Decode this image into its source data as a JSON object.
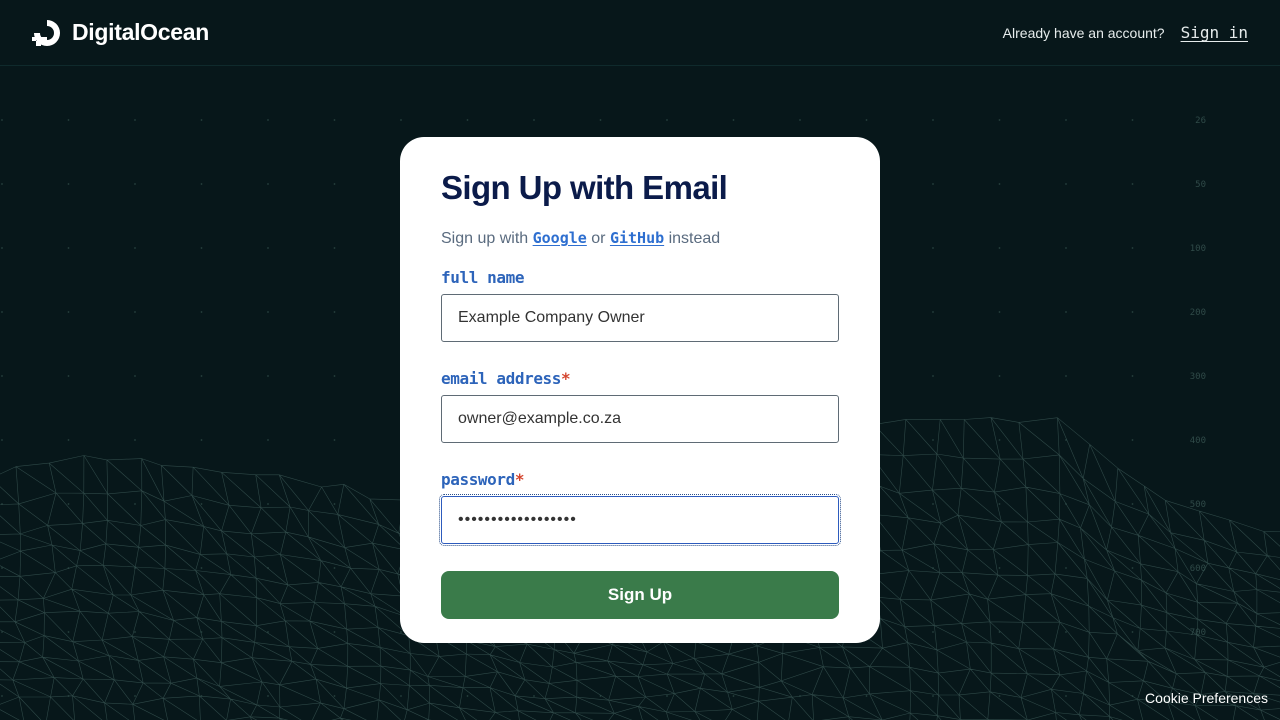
{
  "header": {
    "brand_name": "DigitalOcean",
    "account_prompt": "Already have an account?",
    "signin_label": "Sign in"
  },
  "form": {
    "title": "Sign Up with Email",
    "alt_prefix": "Sign up with",
    "google_label": "Google",
    "or_text": "or",
    "github_label": "GitHub",
    "alt_suffix": "instead",
    "full_name_label": "full name",
    "full_name_value": "Example Company Owner",
    "email_label": "email address",
    "email_value": "owner@example.co.za",
    "password_label": "password",
    "password_value": "secretpassword1234",
    "required_marker": "*",
    "submit_label": "Sign Up"
  },
  "background": {
    "ruler_labels": [
      "26",
      "50",
      "100",
      "200",
      "300",
      "400",
      "500",
      "600",
      "700"
    ]
  },
  "footer": {
    "cookie_label": "Cookie Preferences"
  },
  "colors": {
    "background": "#07171a",
    "brand_button": "#3a7b4a",
    "title": "#0b1b4a",
    "label": "#2d64ba",
    "required": "#d4452e",
    "link": "#2e6fd0"
  }
}
